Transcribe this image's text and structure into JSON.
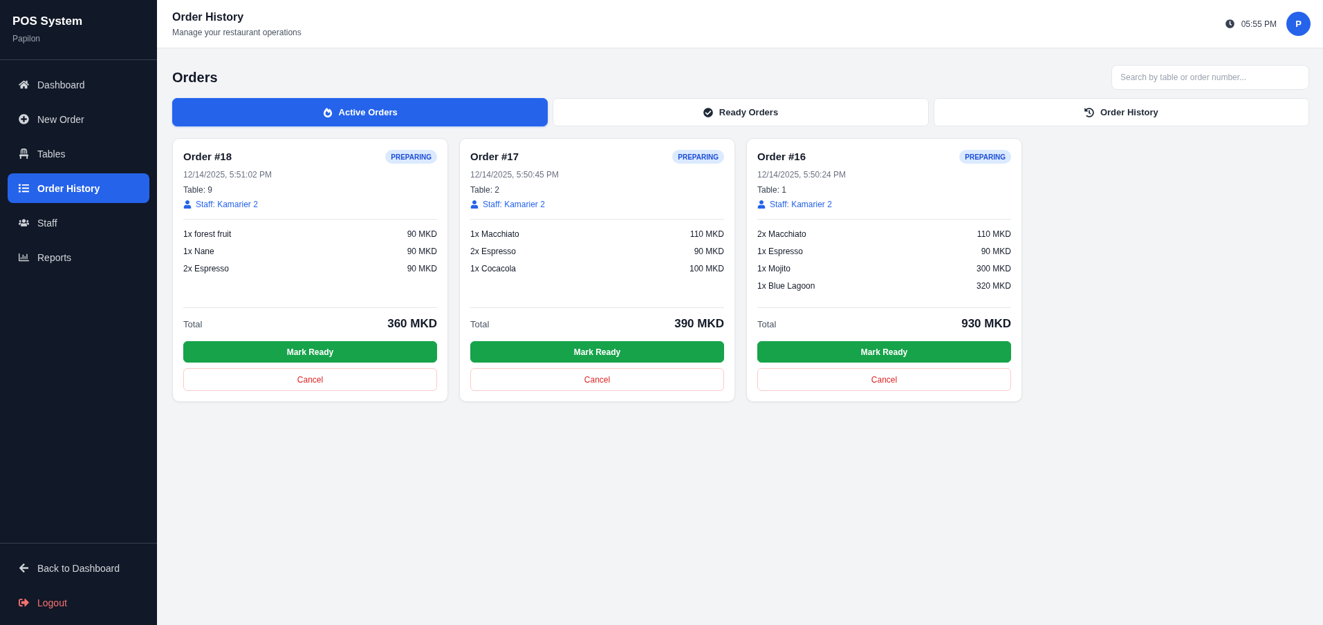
{
  "sidebar": {
    "title": "POS System",
    "subtitle": "Papilon",
    "items": [
      {
        "label": "Dashboard",
        "selected": false
      },
      {
        "label": "New Order",
        "selected": false
      },
      {
        "label": "Tables",
        "selected": false
      },
      {
        "label": "Order History",
        "selected": true
      },
      {
        "label": "Staff",
        "selected": false
      },
      {
        "label": "Reports",
        "selected": false
      }
    ],
    "footer_items": [
      {
        "label": "Back to Dashboard",
        "kind": "back"
      },
      {
        "label": "Logout",
        "kind": "logout"
      }
    ]
  },
  "header": {
    "title": "Order History",
    "subtitle": "Manage your restaurant operations",
    "time": "05:55 PM",
    "avatar": "P"
  },
  "orders_panel": {
    "heading": "Orders",
    "search": {
      "placeholder": "Search by table or order number..."
    },
    "tabs": [
      {
        "label": "Active Orders",
        "selected": true
      },
      {
        "label": "Ready Orders",
        "selected": false
      },
      {
        "label": "Order History",
        "selected": false
      }
    ],
    "orders": [
      {
        "title": "Order #18",
        "status": "PREPARING",
        "date": "12/14/2025, 5:51:02 PM",
        "table": "Table: 9",
        "staff": "Staff: Kamarier 2",
        "items": [
          {
            "name": "1x forest fruit",
            "price": "90 MKD"
          },
          {
            "name": "1x Nane",
            "price": "90 MKD"
          },
          {
            "name": "2x Espresso",
            "price": "90 MKD"
          }
        ],
        "total_label": "Total",
        "total": "360 MKD",
        "actions": [
          {
            "label": "Mark Ready",
            "kind": "confirm"
          },
          {
            "label": "Cancel",
            "kind": "cancel"
          }
        ]
      },
      {
        "title": "Order #17",
        "status": "PREPARING",
        "date": "12/14/2025, 5:50:45 PM",
        "table": "Table: 2",
        "staff": "Staff: Kamarier 2",
        "items": [
          {
            "name": "1x Macchiato",
            "price": "110 MKD"
          },
          {
            "name": "2x Espresso",
            "price": "90 MKD"
          },
          {
            "name": "1x Cocacola",
            "price": "100 MKD"
          }
        ],
        "total_label": "Total",
        "total": "390 MKD",
        "actions": [
          {
            "label": "Mark Ready",
            "kind": "confirm"
          },
          {
            "label": "Cancel",
            "kind": "cancel"
          }
        ]
      },
      {
        "title": "Order #16",
        "status": "PREPARING",
        "date": "12/14/2025, 5:50:24 PM",
        "table": "Table: 1",
        "staff": "Staff: Kamarier 2",
        "items": [
          {
            "name": "2x Macchiato",
            "price": "110 MKD"
          },
          {
            "name": "1x Espresso",
            "price": "90 MKD"
          },
          {
            "name": "1x Mojito",
            "price": "300 MKD"
          },
          {
            "name": "1x Blue Lagoon",
            "price": "320 MKD"
          }
        ],
        "total_label": "Total",
        "total": "930 MKD",
        "actions": [
          {
            "label": "Mark Ready",
            "kind": "confirm"
          },
          {
            "label": "Cancel",
            "kind": "cancel"
          }
        ]
      }
    ]
  }
}
